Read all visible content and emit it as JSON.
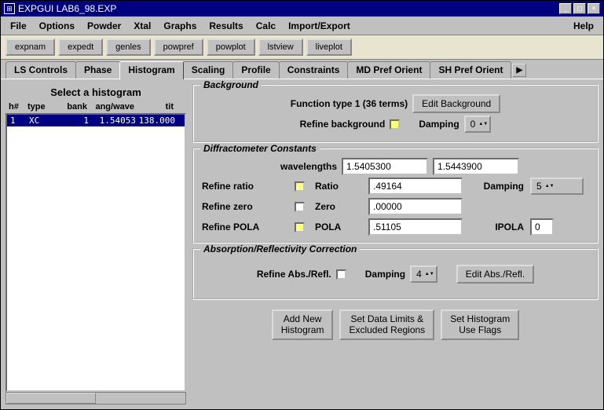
{
  "titlebar": {
    "text": "EXPGUI LAB6_98.EXP"
  },
  "menubar": [
    "File",
    "Options",
    "Powder",
    "Xtal",
    "Graphs",
    "Results",
    "Calc",
    "Import/Export"
  ],
  "menubar_help": "Help",
  "toolbar": [
    "expnam",
    "expedt",
    "genles",
    "powpref",
    "powplot",
    "lstview",
    "liveplot"
  ],
  "tabs": [
    "LS Controls",
    "Phase",
    "Histogram",
    "Scaling",
    "Profile",
    "Constraints",
    "MD Pref Orient",
    "SH Pref Orient"
  ],
  "active_tab": 2,
  "left": {
    "title": "Select a histogram",
    "headers": {
      "h": "h#",
      "type": "type",
      "bank": "bank",
      "angwave": "ang/wave",
      "tit": "tit"
    },
    "row": {
      "h": "1",
      "type": "XC",
      "bank": "1",
      "angwave": "1.54053",
      "tit": "138.000"
    }
  },
  "background": {
    "legend": "Background",
    "func_label": "Function type 1  (36 terms)",
    "edit_btn": "Edit Background",
    "refine_label": "Refine background",
    "damping_label": "Damping",
    "damping_value": "0"
  },
  "diff": {
    "legend": "Diffractometer Constants",
    "wavelengths_label": "wavelengths",
    "wl1": "1.5405300",
    "wl2": "1.5443900",
    "refine_ratio": "Refine ratio",
    "ratio_label": "Ratio",
    "ratio_val": ".49164",
    "damping_label": "Damping",
    "damping_val": "5",
    "refine_zero": "Refine zero",
    "zero_label": "Zero",
    "zero_val": ".00000",
    "refine_pola": "Refine POLA",
    "pola_label": "POLA",
    "pola_val": ".51105",
    "ipola_label": "IPOLA",
    "ipola_val": "0"
  },
  "absorp": {
    "legend": "Absorption/Reflectivity Correction",
    "refine_label": "Refine Abs./Refl.",
    "damping_label": "Damping",
    "damping_val": "4",
    "edit_btn": "Edit Abs./Refl."
  },
  "bottom": {
    "add": "Add New\nHistogram",
    "limits": "Set Data Limits &\nExcluded Regions",
    "flags": "Set Histogram\nUse Flags"
  }
}
